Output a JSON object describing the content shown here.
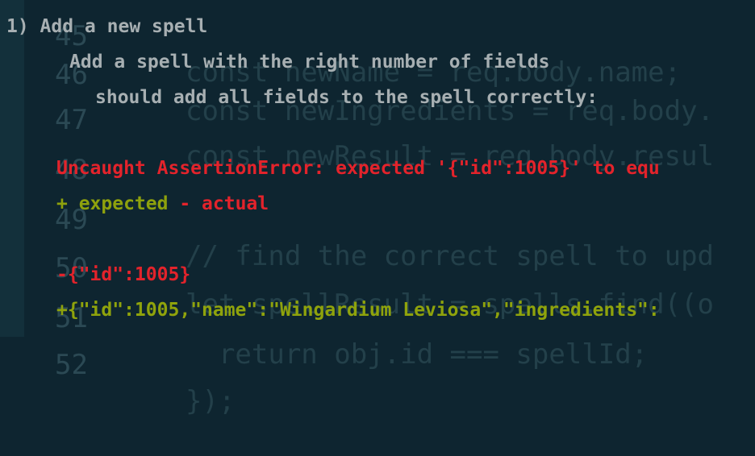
{
  "background_code": {
    "lines": [
      {
        "num": "45",
        "text": "const newName = req.body.name;"
      },
      {
        "num": "46",
        "text": "const newIngredients = req.body."
      },
      {
        "num": "47",
        "text": "const newResult = req.body.resul"
      },
      {
        "num": "48",
        "text": ""
      },
      {
        "num": "49",
        "text": "// find the correct spell to upd"
      },
      {
        "num": "50",
        "text": "let spellResult = spells.find((o"
      },
      {
        "num": "51",
        "text": "  return obj.id === spellId;"
      },
      {
        "num": "52",
        "text": "});"
      }
    ]
  },
  "terminal": {
    "suite_title": "1) Add a new spell",
    "describe_title": "Add a spell with the right number of fields",
    "test_title": "should add all fields to the spell correctly:",
    "error_message": "Uncaught AssertionError: expected '{\"id\":1005}' to equ",
    "diff_legend_expected": "+ expected",
    "diff_legend_actual": "- actual",
    "actual_line": "-{\"id\":1005}",
    "expected_line": "+{\"id\":1005,\"name\":\"Wingardium Leviosa\",\"ingredients\":"
  },
  "colors": {
    "background": "#0e2530",
    "error_red": "#e3232b",
    "diff_green": "#8ea10d",
    "text_gray": "#a7afb2"
  }
}
